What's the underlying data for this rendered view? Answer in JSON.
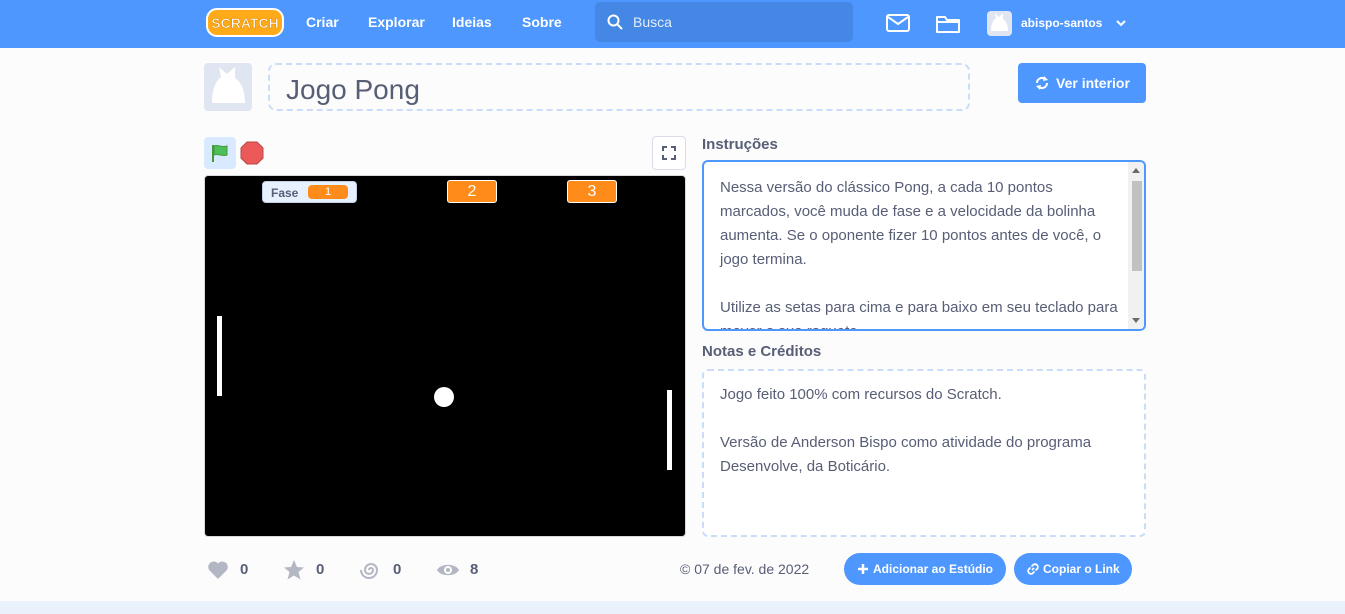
{
  "navbar": {
    "logo_text": "SCRATCH",
    "links": [
      "Criar",
      "Explorar",
      "Ideias",
      "Sobre"
    ],
    "search_placeholder": "Busca",
    "username": "abispo-santos"
  },
  "project": {
    "title": "Jogo Pong",
    "see_inside_label": "Ver interior"
  },
  "stage": {
    "monitor_label": "Fase",
    "monitor_value": "1",
    "score_left": "2",
    "score_right": "3"
  },
  "stats": {
    "loves": "0",
    "favorites": "0",
    "remixes": "0",
    "views": "8"
  },
  "instructions": {
    "title": "Instruções",
    "text": "Nessa versão do clássico Pong, a cada 10 pontos marcados, você muda de fase e a velocidade da bolinha aumenta. Se o oponente fizer 10 pontos antes de você, o jogo termina.\n\nUtilize as setas para cima e para baixo em seu teclado para mover a sua raquete."
  },
  "notes": {
    "title": "Notas e Créditos",
    "text": "Jogo feito 100% com recursos do Scratch.\n\nVersão de Anderson Bispo como atividade do programa Desenvolve, da Boticário."
  },
  "footer_bar": {
    "date": "07 de fev. de 2022",
    "add_studio_label": "Adicionar ao Estúdio",
    "copy_link_label": "Copiar o Link"
  },
  "colors": {
    "brand": "#4d97ff",
    "text": "#575e75",
    "orange": "#ff8c1a"
  }
}
